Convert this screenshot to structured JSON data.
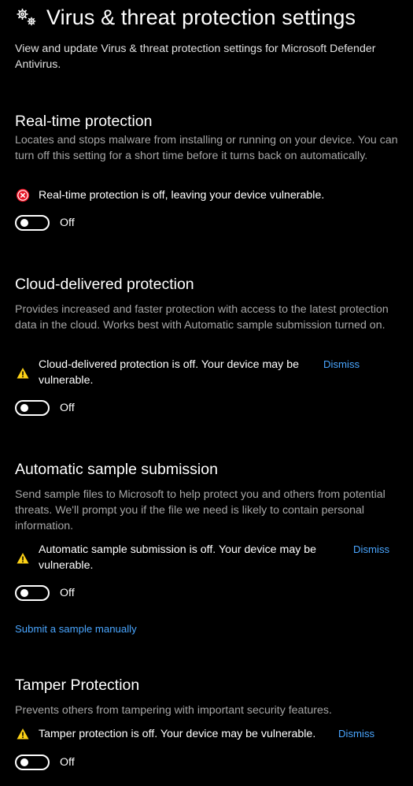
{
  "header": {
    "title": "Virus & threat protection settings",
    "icon": "gears-icon",
    "description": "View and update Virus & threat protection settings for Microsoft Defender Antivirus."
  },
  "colors": {
    "background": "#000000",
    "text": "#ffffff",
    "muted_text": "#a6a6a6",
    "link": "#4aa6ff",
    "error": "#e81123",
    "warning": "#fcd116"
  },
  "sections": [
    {
      "title": "Real-time protection",
      "description": "Locates and stops malware from installing or running on your device. You can turn off this setting for a short time before it turns back on automatically.",
      "alert": {
        "icon": "error-circle-icon",
        "text": "Real-time protection is off, leaving your device vulnerable."
      },
      "toggle": {
        "state": "Off",
        "on": false
      }
    },
    {
      "title": "Cloud-delivered protection",
      "description": "Provides increased and faster protection with access to the latest protection data in the cloud. Works best with Automatic sample submission turned on.",
      "alert": {
        "icon": "warning-triangle-icon",
        "text": "Cloud-delivered protection is off. Your device may be vulnerable.",
        "dismiss": "Dismiss"
      },
      "toggle": {
        "state": "Off",
        "on": false
      }
    },
    {
      "title": "Automatic sample submission",
      "description": "Send sample files to Microsoft to help protect you and others from potential threats. We'll prompt you if the file we need is likely to contain personal information.",
      "alert": {
        "icon": "warning-triangle-icon",
        "text": "Automatic sample submission is off. Your device may be vulnerable.",
        "dismiss": "Dismiss"
      },
      "toggle": {
        "state": "Off",
        "on": false
      },
      "link": "Submit a sample manually"
    },
    {
      "title": "Tamper Protection",
      "description": "Prevents others from tampering with important security features.",
      "alert": {
        "icon": "warning-triangle-icon",
        "text": "Tamper protection is off. Your device may be vulnerable.",
        "dismiss": "Dismiss"
      },
      "toggle": {
        "state": "Off",
        "on": false
      }
    }
  ]
}
